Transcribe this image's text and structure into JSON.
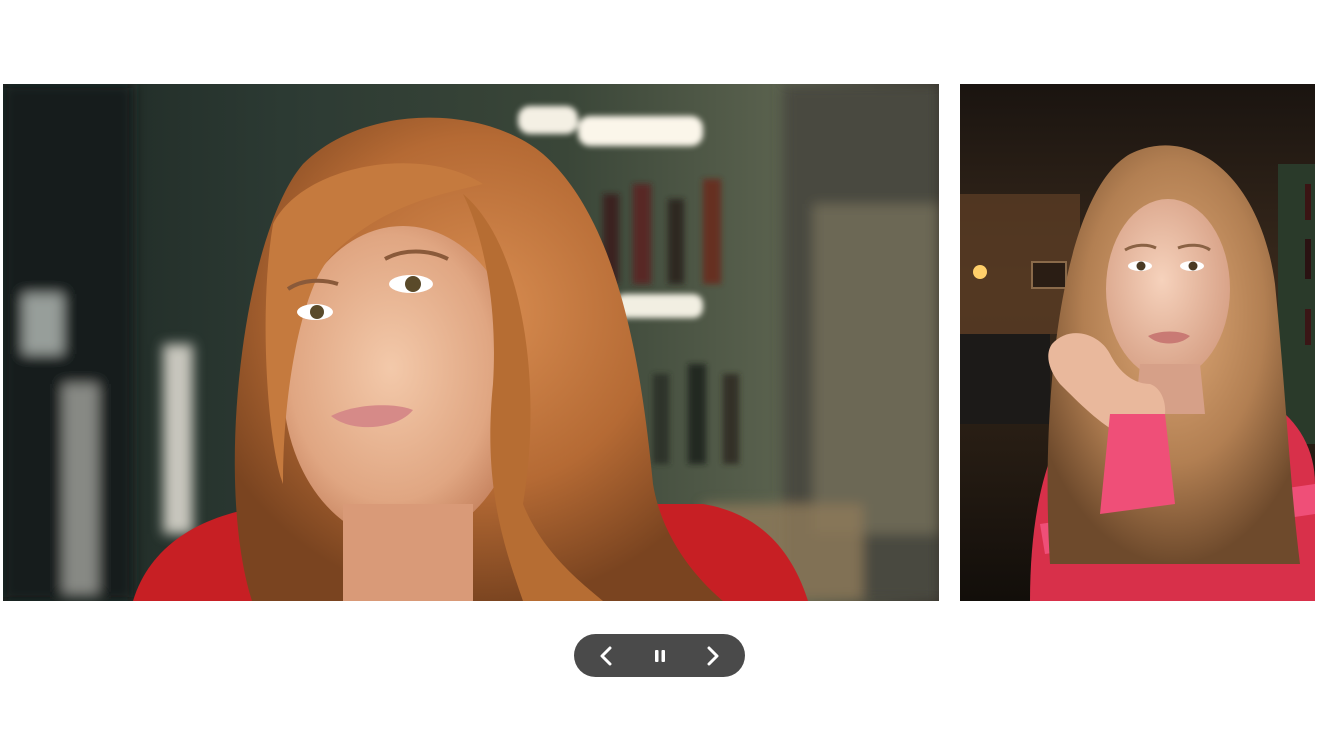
{
  "carousel": {
    "slides": [
      {
        "subject": "woman-portrait-bar-closeup"
      },
      {
        "subject": "woman-portrait-hand-on-chin"
      }
    ],
    "controls": {
      "previous_icon": "chevron-left-icon",
      "pause_icon": "pause-icon",
      "next_icon": "chevron-right-icon"
    }
  },
  "colors": {
    "control_bg": "#4a4a4a",
    "control_fg": "#ffffff",
    "page_bg": "#ffffff"
  }
}
